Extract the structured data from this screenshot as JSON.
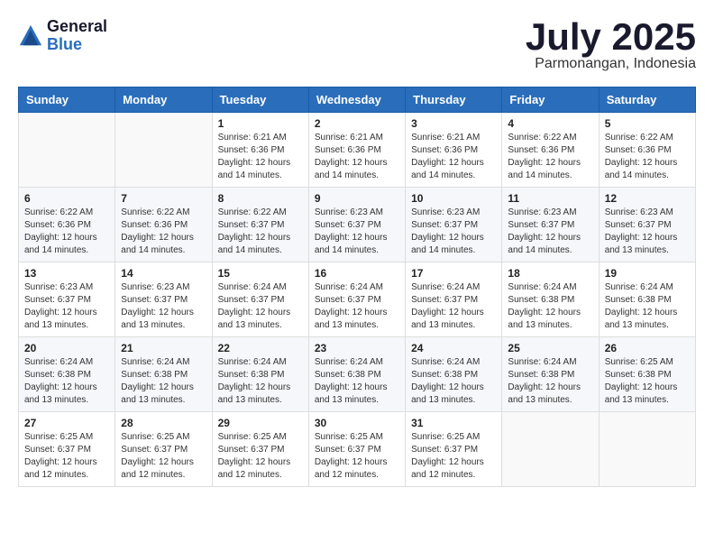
{
  "logo": {
    "general": "General",
    "blue": "Blue"
  },
  "title": {
    "month": "July 2025",
    "location": "Parmonangan, Indonesia"
  },
  "headers": [
    "Sunday",
    "Monday",
    "Tuesday",
    "Wednesday",
    "Thursday",
    "Friday",
    "Saturday"
  ],
  "weeks": [
    [
      {
        "day": "",
        "info": ""
      },
      {
        "day": "",
        "info": ""
      },
      {
        "day": "1",
        "info": "Sunrise: 6:21 AM\nSunset: 6:36 PM\nDaylight: 12 hours and 14 minutes."
      },
      {
        "day": "2",
        "info": "Sunrise: 6:21 AM\nSunset: 6:36 PM\nDaylight: 12 hours and 14 minutes."
      },
      {
        "day": "3",
        "info": "Sunrise: 6:21 AM\nSunset: 6:36 PM\nDaylight: 12 hours and 14 minutes."
      },
      {
        "day": "4",
        "info": "Sunrise: 6:22 AM\nSunset: 6:36 PM\nDaylight: 12 hours and 14 minutes."
      },
      {
        "day": "5",
        "info": "Sunrise: 6:22 AM\nSunset: 6:36 PM\nDaylight: 12 hours and 14 minutes."
      }
    ],
    [
      {
        "day": "6",
        "info": "Sunrise: 6:22 AM\nSunset: 6:36 PM\nDaylight: 12 hours and 14 minutes."
      },
      {
        "day": "7",
        "info": "Sunrise: 6:22 AM\nSunset: 6:36 PM\nDaylight: 12 hours and 14 minutes."
      },
      {
        "day": "8",
        "info": "Sunrise: 6:22 AM\nSunset: 6:37 PM\nDaylight: 12 hours and 14 minutes."
      },
      {
        "day": "9",
        "info": "Sunrise: 6:23 AM\nSunset: 6:37 PM\nDaylight: 12 hours and 14 minutes."
      },
      {
        "day": "10",
        "info": "Sunrise: 6:23 AM\nSunset: 6:37 PM\nDaylight: 12 hours and 14 minutes."
      },
      {
        "day": "11",
        "info": "Sunrise: 6:23 AM\nSunset: 6:37 PM\nDaylight: 12 hours and 14 minutes."
      },
      {
        "day": "12",
        "info": "Sunrise: 6:23 AM\nSunset: 6:37 PM\nDaylight: 12 hours and 13 minutes."
      }
    ],
    [
      {
        "day": "13",
        "info": "Sunrise: 6:23 AM\nSunset: 6:37 PM\nDaylight: 12 hours and 13 minutes."
      },
      {
        "day": "14",
        "info": "Sunrise: 6:23 AM\nSunset: 6:37 PM\nDaylight: 12 hours and 13 minutes."
      },
      {
        "day": "15",
        "info": "Sunrise: 6:24 AM\nSunset: 6:37 PM\nDaylight: 12 hours and 13 minutes."
      },
      {
        "day": "16",
        "info": "Sunrise: 6:24 AM\nSunset: 6:37 PM\nDaylight: 12 hours and 13 minutes."
      },
      {
        "day": "17",
        "info": "Sunrise: 6:24 AM\nSunset: 6:37 PM\nDaylight: 12 hours and 13 minutes."
      },
      {
        "day": "18",
        "info": "Sunrise: 6:24 AM\nSunset: 6:38 PM\nDaylight: 12 hours and 13 minutes."
      },
      {
        "day": "19",
        "info": "Sunrise: 6:24 AM\nSunset: 6:38 PM\nDaylight: 12 hours and 13 minutes."
      }
    ],
    [
      {
        "day": "20",
        "info": "Sunrise: 6:24 AM\nSunset: 6:38 PM\nDaylight: 12 hours and 13 minutes."
      },
      {
        "day": "21",
        "info": "Sunrise: 6:24 AM\nSunset: 6:38 PM\nDaylight: 12 hours and 13 minutes."
      },
      {
        "day": "22",
        "info": "Sunrise: 6:24 AM\nSunset: 6:38 PM\nDaylight: 12 hours and 13 minutes."
      },
      {
        "day": "23",
        "info": "Sunrise: 6:24 AM\nSunset: 6:38 PM\nDaylight: 12 hours and 13 minutes."
      },
      {
        "day": "24",
        "info": "Sunrise: 6:24 AM\nSunset: 6:38 PM\nDaylight: 12 hours and 13 minutes."
      },
      {
        "day": "25",
        "info": "Sunrise: 6:24 AM\nSunset: 6:38 PM\nDaylight: 12 hours and 13 minutes."
      },
      {
        "day": "26",
        "info": "Sunrise: 6:25 AM\nSunset: 6:38 PM\nDaylight: 12 hours and 13 minutes."
      }
    ],
    [
      {
        "day": "27",
        "info": "Sunrise: 6:25 AM\nSunset: 6:37 PM\nDaylight: 12 hours and 12 minutes."
      },
      {
        "day": "28",
        "info": "Sunrise: 6:25 AM\nSunset: 6:37 PM\nDaylight: 12 hours and 12 minutes."
      },
      {
        "day": "29",
        "info": "Sunrise: 6:25 AM\nSunset: 6:37 PM\nDaylight: 12 hours and 12 minutes."
      },
      {
        "day": "30",
        "info": "Sunrise: 6:25 AM\nSunset: 6:37 PM\nDaylight: 12 hours and 12 minutes."
      },
      {
        "day": "31",
        "info": "Sunrise: 6:25 AM\nSunset: 6:37 PM\nDaylight: 12 hours and 12 minutes."
      },
      {
        "day": "",
        "info": ""
      },
      {
        "day": "",
        "info": ""
      }
    ]
  ]
}
